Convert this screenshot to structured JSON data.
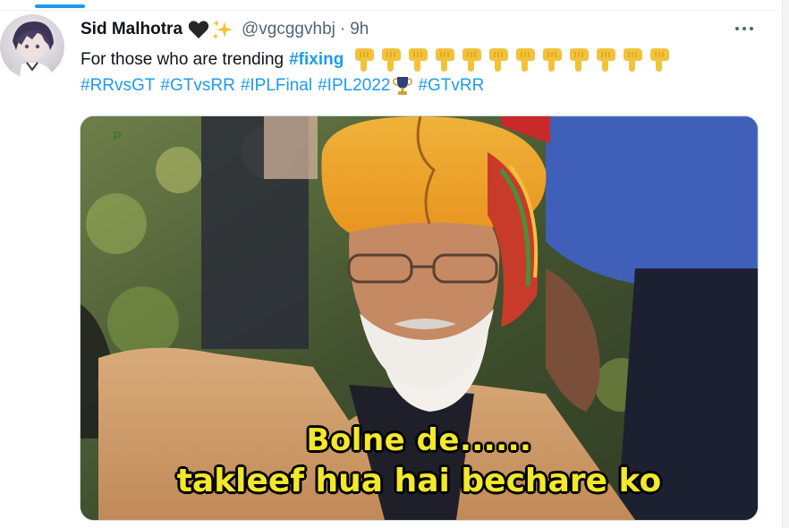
{
  "tweet": {
    "author_name": "Sid Malhotra",
    "handle": "@vgcggvhbj",
    "separator": "·",
    "time": "9h",
    "text_intro": "For those who are trending",
    "text_hashtag_bold": "#fixing",
    "pointer_emoji_count": 12,
    "hashtags": [
      "#RRvsGT",
      "#GTvsRR",
      "#IPLFinal",
      "#IPL2022",
      "#GTvRR"
    ],
    "icons": {
      "heart": "black-heart-icon",
      "sparkles": "sparkles-icon",
      "pointer": "backhand-index-pointing-down-icon",
      "trophy": "trophy-icon",
      "more": "more-options-icon"
    },
    "colors": {
      "link": "#1d9bf0",
      "text": "#0f1419",
      "muted": "#536471",
      "caption": "#f3e82a"
    }
  },
  "media": {
    "watermark": "P",
    "caption_line1": "Bolne de......",
    "caption_line2": "takleef hua hai bechare ko"
  }
}
